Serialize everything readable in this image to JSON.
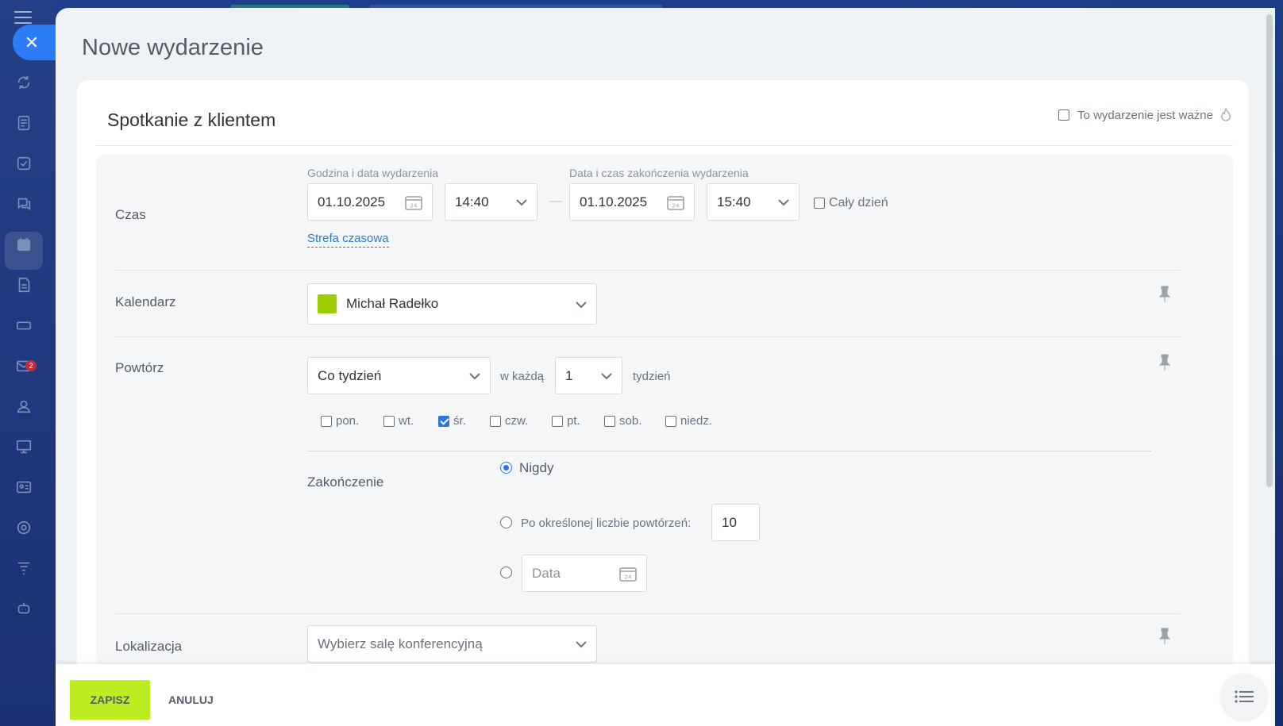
{
  "sidebar": {
    "close_label": "✕",
    "mail_badge": "2",
    "icons": [
      "sync-icon",
      "document-icon",
      "tasks-icon",
      "chat-icon",
      "calendar-icon",
      "file-icon",
      "storage-icon",
      "mail-icon",
      "contacts-icon",
      "presentation-icon",
      "id-card-icon",
      "target-icon",
      "filter-icon",
      "robot-icon"
    ]
  },
  "header": {
    "title": "Nowe wydarzenie"
  },
  "event": {
    "name": "Spotkanie z klientem",
    "important_label": "To wydarzenie jest ważne"
  },
  "time": {
    "label": "Czas",
    "start_caption": "Godzina i data wydarzenia",
    "end_caption": "Data i czas zakończenia wydarzenia",
    "start_date": "01.10.2025",
    "start_time": "14:40",
    "end_date": "01.10.2025",
    "end_time": "15:40",
    "separator": "—",
    "all_day_label": "Cały dzień",
    "timezone_link": "Strefa czasowa"
  },
  "calendar": {
    "label": "Kalendarz",
    "value": "Michał Radełko",
    "color": "#9dcf00"
  },
  "repeat": {
    "label": "Powtórz",
    "frequency": "Co tydzień",
    "every_label": "w każdą",
    "interval": "1",
    "unit_label": "tydzień",
    "days": [
      {
        "label": "pon.",
        "checked": false
      },
      {
        "label": "wt.",
        "checked": false
      },
      {
        "label": "śr.",
        "checked": true
      },
      {
        "label": "czw.",
        "checked": false
      },
      {
        "label": "pt.",
        "checked": false
      },
      {
        "label": "sob.",
        "checked": false
      },
      {
        "label": "niedz.",
        "checked": false
      }
    ],
    "end_label": "Zakończenie",
    "end_never": "Nigdy",
    "end_after_count": "Po określonej liczbie powtórzeń:",
    "count_value": "10",
    "end_date_placeholder": "Data"
  },
  "location": {
    "label": "Lokalizacja",
    "placeholder": "Wybierz salę konferencyjną"
  },
  "footer": {
    "save_label": "ZAPISZ",
    "cancel_label": "ANULUJ"
  },
  "colors": {
    "accent_blue": "#2b74e2",
    "save_green": "#bbed21",
    "link_blue": "#2e7bc4"
  }
}
